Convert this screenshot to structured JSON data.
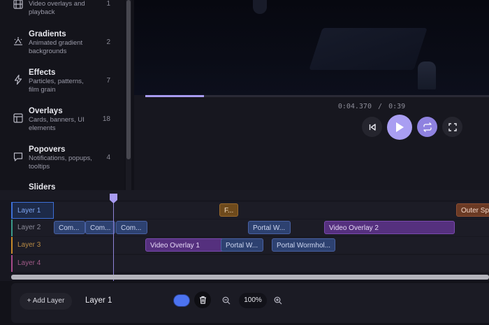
{
  "sidebar": {
    "items": [
      {
        "title": "",
        "desc": "Video overlays and playback",
        "count": "1",
        "icon": "film-icon"
      },
      {
        "title": "Gradients",
        "desc": "Animated gradient backgrounds",
        "count": "2",
        "icon": "gradient-icon"
      },
      {
        "title": "Effects",
        "desc": "Particles, patterns, film grain",
        "count": "7",
        "icon": "lightning-icon"
      },
      {
        "title": "Overlays",
        "desc": "Cards, banners, UI elements",
        "count": "18",
        "icon": "layout-icon"
      },
      {
        "title": "Popovers",
        "desc": "Notifications, popups, tooltips",
        "count": "4",
        "icon": "message-icon"
      },
      {
        "title": "Sliders",
        "desc": "",
        "count": "",
        "icon": ""
      }
    ]
  },
  "player": {
    "current_time": "0:04.370",
    "separator": "/",
    "duration": "0:39",
    "progress": 0.17
  },
  "timeline": {
    "tracks": [
      {
        "label": "Layer 1",
        "color": "#3d6fd6",
        "text_color": "#7fa6f2",
        "selected": true,
        "clips": [
          {
            "text": "F...",
            "style": "orange"
          },
          {
            "text": "Outer Sp",
            "style": "rust"
          }
        ]
      },
      {
        "label": "Layer 2",
        "color": "#3a9a8a",
        "text_color": "#8a8a98",
        "selected": false,
        "clips": [
          {
            "text": "Com...",
            "style": "blue"
          },
          {
            "text": "Com...",
            "style": "blue"
          },
          {
            "text": "Com...",
            "style": "blue"
          },
          {
            "text": "Portal W...",
            "style": "blue"
          },
          {
            "text": "Video Overlay 2",
            "style": "purple"
          }
        ]
      },
      {
        "label": "Layer 3",
        "color": "#c78a2a",
        "text_color": "#b88a44",
        "selected": false,
        "clips": [
          {
            "text": "Video Overlay 1",
            "style": "purple"
          },
          {
            "text": "Portal W...",
            "style": "blue"
          },
          {
            "text": "Portal Wormhol...",
            "style": "blue"
          }
        ]
      },
      {
        "label": "Layer 4",
        "color": "#a84a8a",
        "text_color": "#a05a88",
        "selected": false,
        "clips": []
      }
    ]
  },
  "toolbar": {
    "add_layer": "+ Add Layer",
    "layer_name": "Layer 1",
    "zoom": "100%",
    "toggle_on": true
  },
  "colors": {
    "accent": "#a89bf0",
    "toggle": "#4c73f0"
  }
}
